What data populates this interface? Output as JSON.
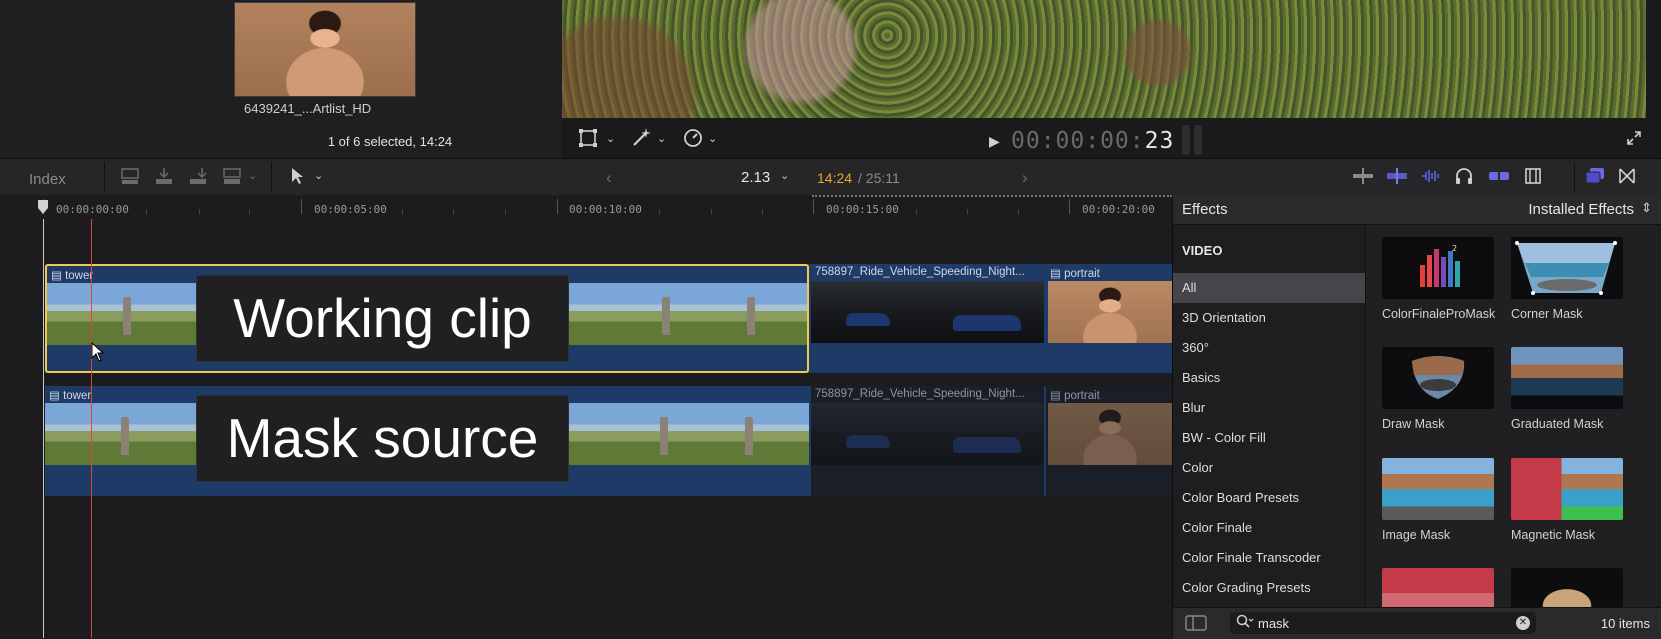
{
  "browser": {
    "clip_name": "6439241_...Artlist_HD",
    "selection_status": "1 of 6 selected, 14:24"
  },
  "viewer": {
    "timecode_dim": "00:00:00:",
    "timecode_frames": "23"
  },
  "timeline_toolbar": {
    "index_label": "Index",
    "zoom": "2.13",
    "current_time": "14:24",
    "total_time": "/ 25:11"
  },
  "ruler": {
    "ticks": [
      "00:00:00:00",
      "00:00:05:00",
      "00:00:10:00",
      "00:00:15:00",
      "00:00:20:00"
    ]
  },
  "tracks": {
    "upper": {
      "clips": [
        "tower",
        "758897_Ride_Vehicle_Speeding_Night...",
        "portrait"
      ],
      "overlay_label": "Working clip"
    },
    "lower": {
      "clips": [
        "tower",
        "758897_Ride_Vehicle_Speeding_Night...",
        "portrait"
      ],
      "overlay_label": "Mask source"
    }
  },
  "effects": {
    "title": "Effects",
    "library_selector": "Installed Effects",
    "section_header": "VIDEO",
    "categories": [
      "All",
      "3D Orientation",
      "360°",
      "Basics",
      "Blur",
      "BW - Color Fill",
      "Color",
      "Color Board Presets",
      "Color Finale",
      "Color Finale Transcoder",
      "Color Grading Presets"
    ],
    "selected_category": "All",
    "items": [
      {
        "name": "ColorFinaleProMask",
        "icon": "colorfinale-bars-icon"
      },
      {
        "name": "Corner Mask",
        "icon": "corner-mask-preview"
      },
      {
        "name": "Draw Mask",
        "icon": "draw-mask-preview"
      },
      {
        "name": "Graduated Mask",
        "icon": "graduated-mask-preview"
      },
      {
        "name": "Image Mask",
        "icon": "image-mask-preview"
      },
      {
        "name": "Magnetic Mask",
        "icon": "magnetic-mask-preview"
      }
    ],
    "search": {
      "value": "mask"
    },
    "item_count": "10 items"
  },
  "colors": {
    "selection_yellow": "#f2c94c",
    "track_blue": "#1e3a66",
    "current_time_gold": "#e0a82e",
    "playhead_red": "#e0453a",
    "toolbar_accent": "#6b68e8"
  }
}
